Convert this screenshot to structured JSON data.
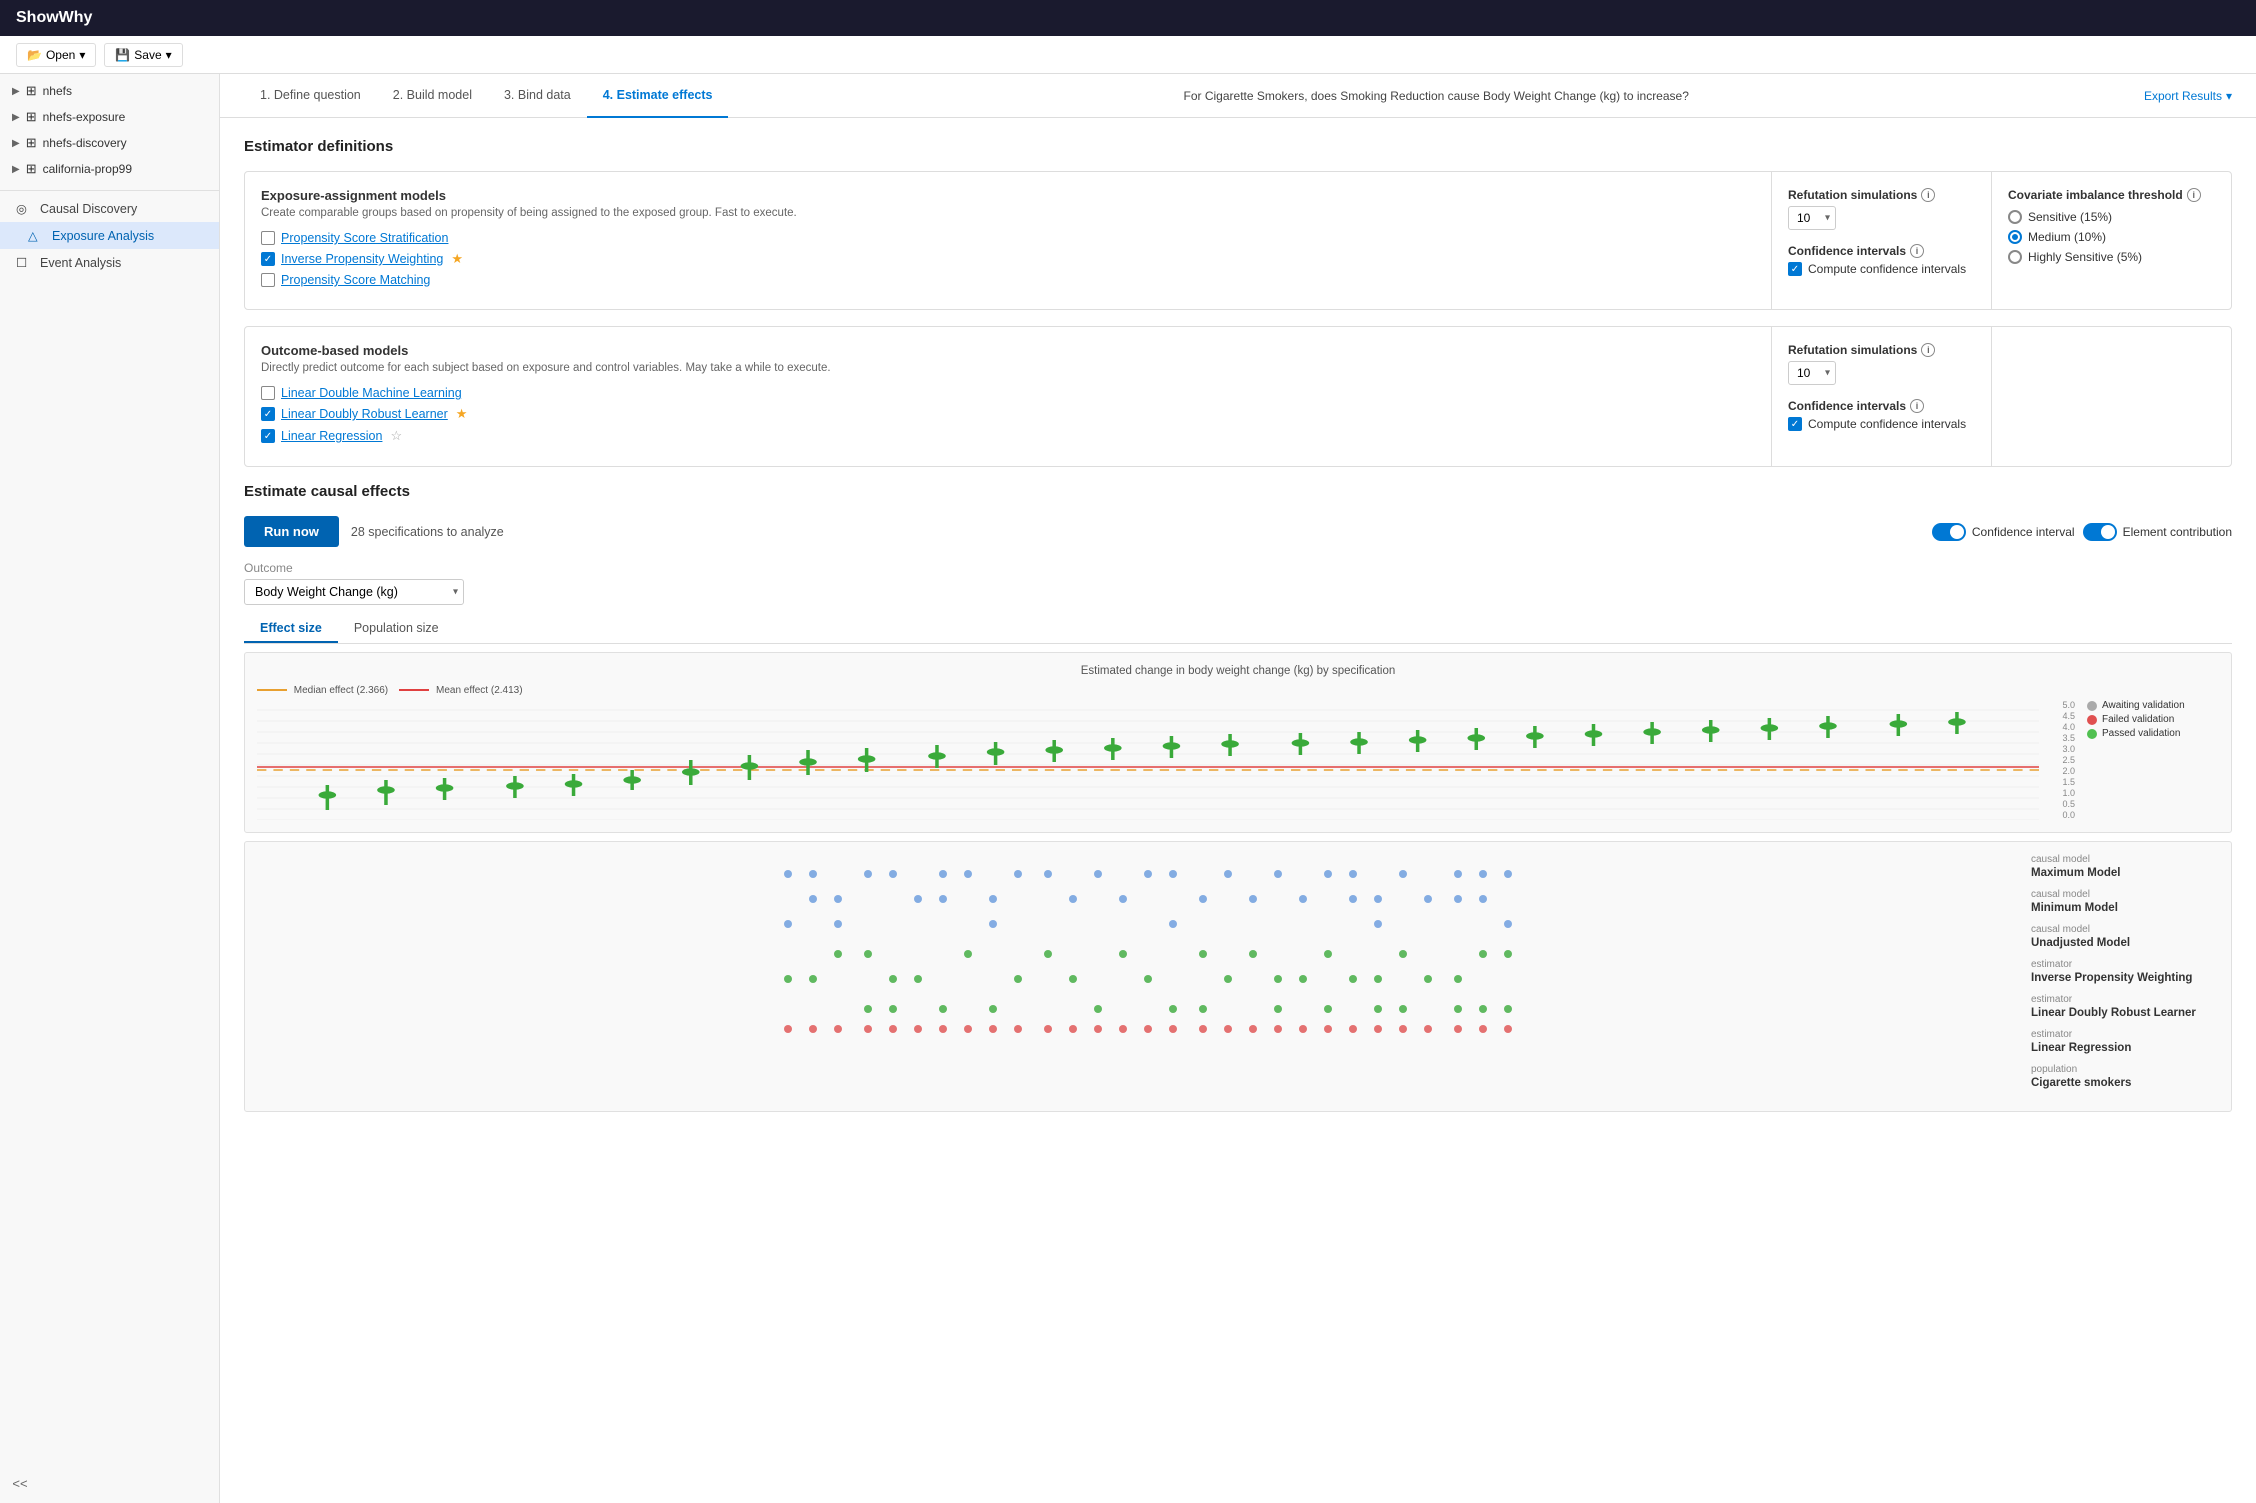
{
  "app": {
    "title": "ShowWhy"
  },
  "menubar": {
    "open_label": "Open",
    "save_label": "Save"
  },
  "sidebar": {
    "datasets": [
      {
        "id": "nhefs",
        "label": "nhefs"
      },
      {
        "id": "nhefs-exposure",
        "label": "nhefs-exposure"
      },
      {
        "id": "nhefs-discovery",
        "label": "nhefs-discovery"
      },
      {
        "id": "california-prop99",
        "label": "california-prop99"
      }
    ],
    "nav": [
      {
        "id": "causal-discovery",
        "label": "Causal Discovery",
        "active": false
      },
      {
        "id": "exposure-analysis",
        "label": "Exposure Analysis",
        "active": true
      },
      {
        "id": "event-analysis",
        "label": "Event Analysis",
        "active": false
      }
    ],
    "collapse_label": "<<"
  },
  "steps": [
    {
      "id": "define-question",
      "label": "1. Define question"
    },
    {
      "id": "build-model",
      "label": "2. Build model"
    },
    {
      "id": "bind-data",
      "label": "3. Bind data"
    },
    {
      "id": "estimate-effects",
      "label": "4. Estimate effects",
      "active": true
    }
  ],
  "question": "For Cigarette Smokers, does Smoking Reduction cause Body Weight Change (kg) to increase?",
  "export_label": "Export Results",
  "estimator_definitions": {
    "title": "Estimator definitions",
    "exposure_card": {
      "title": "Exposure-assignment models",
      "description": "Create comparable groups based on propensity of being assigned to the exposed group. Fast to execute.",
      "methods": [
        {
          "id": "propensity-score-stratification",
          "label": "Propensity Score Stratification",
          "checked": false,
          "starred": false
        },
        {
          "id": "inverse-propensity-weighting",
          "label": "Inverse Propensity Weighting",
          "checked": true,
          "starred": true
        },
        {
          "id": "propensity-score-matching",
          "label": "Propensity Score Matching",
          "checked": false,
          "starred": false
        }
      ],
      "refutation": {
        "label": "Refutation simulations",
        "value": "10"
      },
      "confidence": {
        "label": "Confidence intervals",
        "checked": true,
        "text": "Compute confidence intervals"
      }
    },
    "outcome_card": {
      "title": "Outcome-based models",
      "description": "Directly predict outcome for each subject based on exposure and control variables. May take a while to execute.",
      "methods": [
        {
          "id": "linear-double-ml",
          "label": "Linear Double Machine Learning",
          "checked": false,
          "starred": false
        },
        {
          "id": "linear-doubly-robust",
          "label": "Linear Doubly Robust Learner",
          "checked": true,
          "starred": true,
          "star_filled": true
        },
        {
          "id": "linear-regression",
          "label": "Linear Regression",
          "checked": true,
          "starred": false,
          "star_outline": true
        }
      ],
      "refutation": {
        "label": "Refutation simulations",
        "value": "10"
      },
      "confidence": {
        "label": "Confidence intervals",
        "checked": true,
        "text": "Compute confidence intervals"
      }
    },
    "covariate": {
      "title": "Covariate imbalance threshold",
      "options": [
        {
          "id": "sensitive",
          "label": "Sensitive (15%)",
          "selected": false
        },
        {
          "id": "medium",
          "label": "Medium (10%)",
          "selected": true
        },
        {
          "id": "highly-sensitive",
          "label": "Highly Sensitive (5%)",
          "selected": false
        }
      ]
    }
  },
  "estimate": {
    "title": "Estimate causal effects",
    "run_label": "Run now",
    "spec_text": "28 specifications to analyze",
    "confidence_interval_label": "Confidence interval",
    "element_contribution_label": "Element contribution",
    "outcome_label": "Outcome",
    "outcome_placeholder": "Body Weight Change (kg)",
    "tabs": [
      {
        "id": "effect-size",
        "label": "Effect size",
        "active": true
      },
      {
        "id": "population-size",
        "label": "Population size",
        "active": false
      }
    ],
    "chart": {
      "title": "Estimated change in body weight change (kg) by specification",
      "median_label": "Median effect (2.366)",
      "mean_label": "Mean effect (2.413)",
      "y_axis": [
        "5.0",
        "4.5",
        "4.0",
        "3.5",
        "3.0",
        "2.5",
        "2.0",
        "1.5",
        "1.0",
        "0.5",
        "0.0"
      ],
      "legend": [
        {
          "color": "#aaaaaa",
          "label": "Awaiting validation",
          "type": "dot"
        },
        {
          "color": "#e05050",
          "label": "Failed validation",
          "type": "dot"
        },
        {
          "color": "#50c050",
          "label": "Passed validation",
          "type": "dot"
        }
      ]
    },
    "scatter_legend": [
      {
        "type": "causal_model",
        "label": "Maximum Model"
      },
      {
        "type": "causal_model",
        "label": "Minimum Model"
      },
      {
        "type": "causal_model",
        "label": "Unadjusted Model"
      },
      {
        "type": "estimator",
        "label": "Inverse Propensity Weighting"
      },
      {
        "type": "estimator",
        "label": "Linear Doubly Robust Learner"
      },
      {
        "type": "estimator",
        "label": "Linear Regression"
      },
      {
        "type": "population",
        "label": "Cigarette smokers"
      }
    ]
  }
}
